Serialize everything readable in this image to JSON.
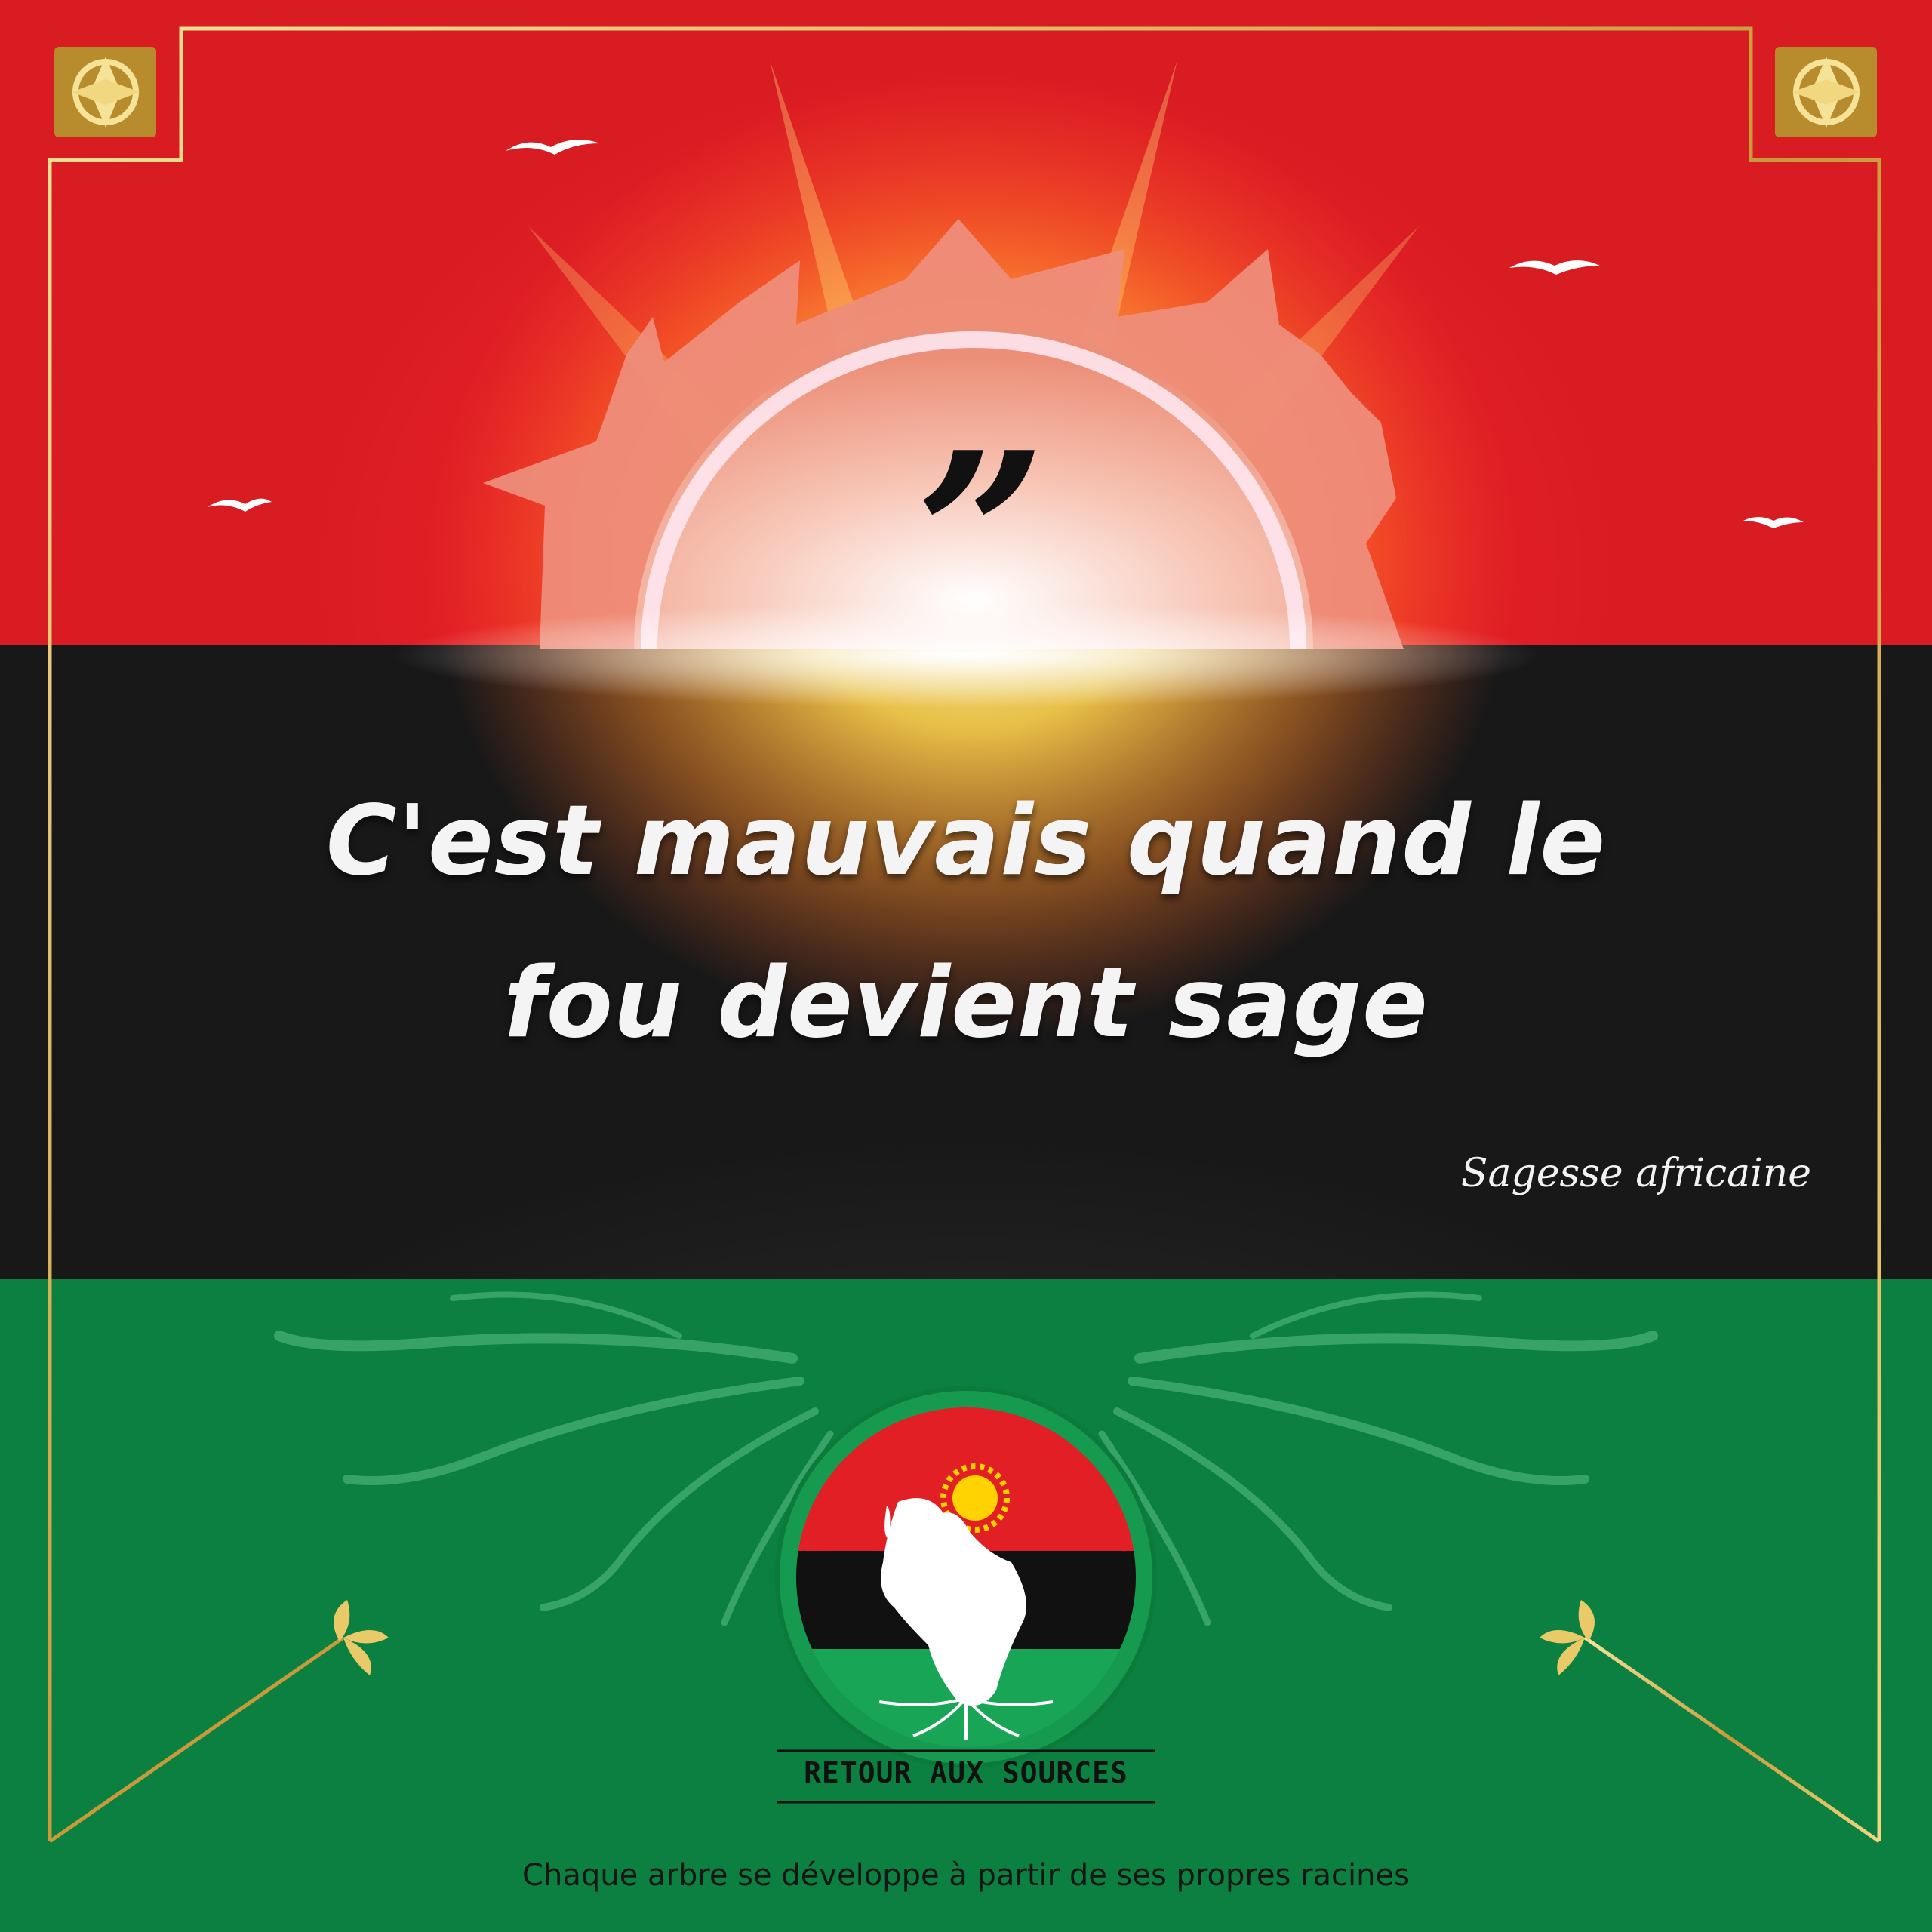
{
  "quote": {
    "mark": "”",
    "line_1": "C'est mauvais quand le",
    "line_2": "fou devient sage",
    "attribution": "Sagesse africaine"
  },
  "brand": {
    "name": "RETOUR AUX SOURCES",
    "tagline": "Chaque arbre se développe à partir de ses propres racines"
  },
  "colors": {
    "red": "#e11f25",
    "black": "#1c1c1c",
    "green": "#0e8c46",
    "gold": "#d9b458",
    "sun_glow": "#ffd34d",
    "text_light": "#f4f4f4"
  },
  "icons": [
    "sun-icon",
    "bird-icon",
    "ornament-icon",
    "leaf-sprig-icon",
    "africa-map-icon",
    "roots-icon"
  ]
}
